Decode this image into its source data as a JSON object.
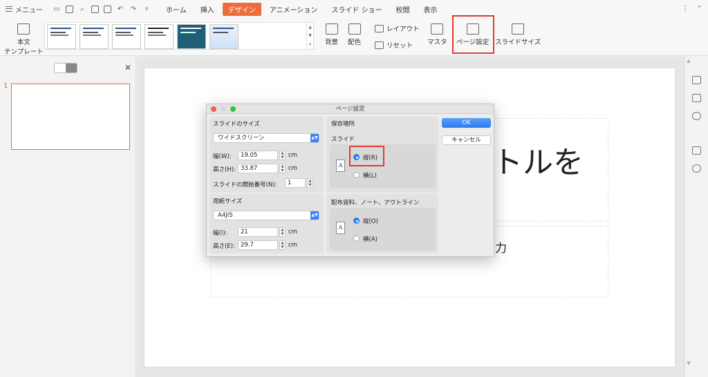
{
  "menubar": {
    "menu_label": "メニュー",
    "tabs": [
      {
        "label": "ホーム",
        "active": false
      },
      {
        "label": "挿入",
        "active": false
      },
      {
        "label": "デザイン",
        "active": true
      },
      {
        "label": "アニメーション",
        "active": false
      },
      {
        "label": "スライド ショー",
        "active": false
      },
      {
        "label": "校閲",
        "active": false
      },
      {
        "label": "表示",
        "active": false
      }
    ]
  },
  "ribbon": {
    "template_label_1": "本文",
    "template_label_2": "テンプレート",
    "background_label": "背景",
    "color_scheme_label": "配色",
    "layout_label": "レイアウト",
    "reset_label": "リセット",
    "master_label": "マスタ",
    "page_setup_label": "ページ設定",
    "slide_size_label": "スライドサイズ"
  },
  "left_panel": {
    "slide_number": "1"
  },
  "slide": {
    "title_fragment": "トルを",
    "subtitle_fragment": "力"
  },
  "dialog": {
    "title": "ページ設定",
    "slide_size_section": "スライドのサイズ",
    "slide_size_value": "ワイドスクリーン",
    "width_label": "幅(W):",
    "width_value": "19.05",
    "height_label": "高さ(H):",
    "height_value": "33.87",
    "unit": "cm",
    "start_number_label": "スライドの開始番号(N):",
    "start_number_value": "1",
    "paper_size_section": "用紙サイズ",
    "paper_size_value": "A4JIS",
    "paper_width_label": "幅(I):",
    "paper_width_value": "21",
    "paper_height_label": "高さ(E):",
    "paper_height_value": "29.7",
    "orientation_section": "保存場所",
    "slide_group_label": "スライド",
    "slide_portrait_label": "縦(R)",
    "slide_landscape_label": "横(L)",
    "handout_group_label": "配布資料、ノート、アウトライン",
    "handout_portrait_label": "縦(O)",
    "handout_landscape_label": "横(A)",
    "ok_label": "OK",
    "cancel_label": "キャンセル"
  },
  "colors": {
    "accent": "#ea6d3a",
    "highlight": "#e03a2f",
    "primary_button": "#2c78ee"
  }
}
